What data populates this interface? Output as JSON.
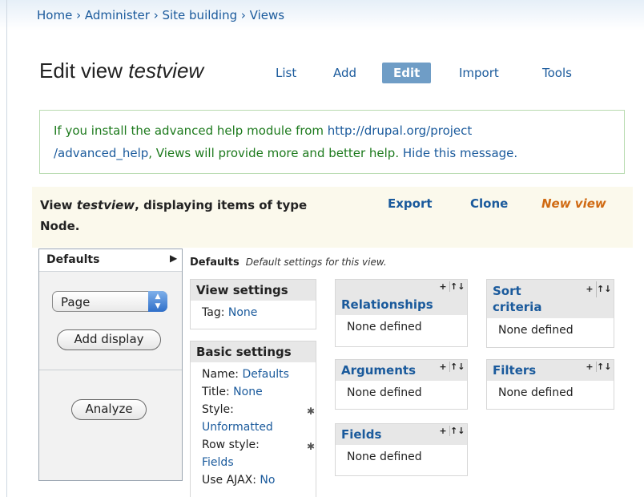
{
  "breadcrumb": [
    "Home",
    "Administer",
    "Site building",
    "Views"
  ],
  "breadcrumb_sep": " › ",
  "page_title_prefix": "Edit view ",
  "page_title_view": "testview",
  "tabs": [
    "List",
    "Add",
    "Edit",
    "Import",
    "Tools"
  ],
  "active_tab": "Edit",
  "help": {
    "text_before": "If you install the advanced help module from ",
    "link_url_1": "http://drupal.org/project",
    "link_url_2": "/advanced_help",
    "text_after": ", Views will provide more and better help. ",
    "hide_link": "Hide this message."
  },
  "viewbar": {
    "desc_prefix": "View ",
    "desc_view": "testview",
    "desc_suffix": ", displaying items of type",
    "desc_line2": "Node.",
    "export": "Export",
    "clone": "Clone",
    "new_view": "New view"
  },
  "displays": {
    "current_tab": "Defaults",
    "select_value": "Page",
    "add_display": "Add display",
    "analyze": "Analyze"
  },
  "main_header": {
    "name": "Defaults",
    "desc": "Default settings for this view."
  },
  "view_settings": {
    "title": "View settings",
    "tag_label": "Tag: ",
    "tag_value": "None"
  },
  "basic_settings": {
    "title": "Basic settings",
    "name_label": "Name: ",
    "name_value": "Defaults",
    "title_label": "Title: ",
    "title_value": "None",
    "style_label": "Style:",
    "style_value": "Unformatted",
    "row_style_label": "Row style:",
    "row_style_value": "Fields",
    "ajax_label": "Use AJAX: ",
    "ajax_value": "No"
  },
  "relationships": {
    "title": "Relationships",
    "body": "None defined"
  },
  "arguments": {
    "title": "Arguments",
    "body": "None defined"
  },
  "fields": {
    "title": "Fields",
    "body": "None defined"
  },
  "sort_criteria": {
    "title_line1": "Sort",
    "title_line2": "criteria",
    "body": "None defined"
  },
  "filters": {
    "title": "Filters",
    "body": "None defined"
  },
  "icons": {
    "add": "+",
    "rearrange": "↑↓",
    "gear": "✱"
  }
}
